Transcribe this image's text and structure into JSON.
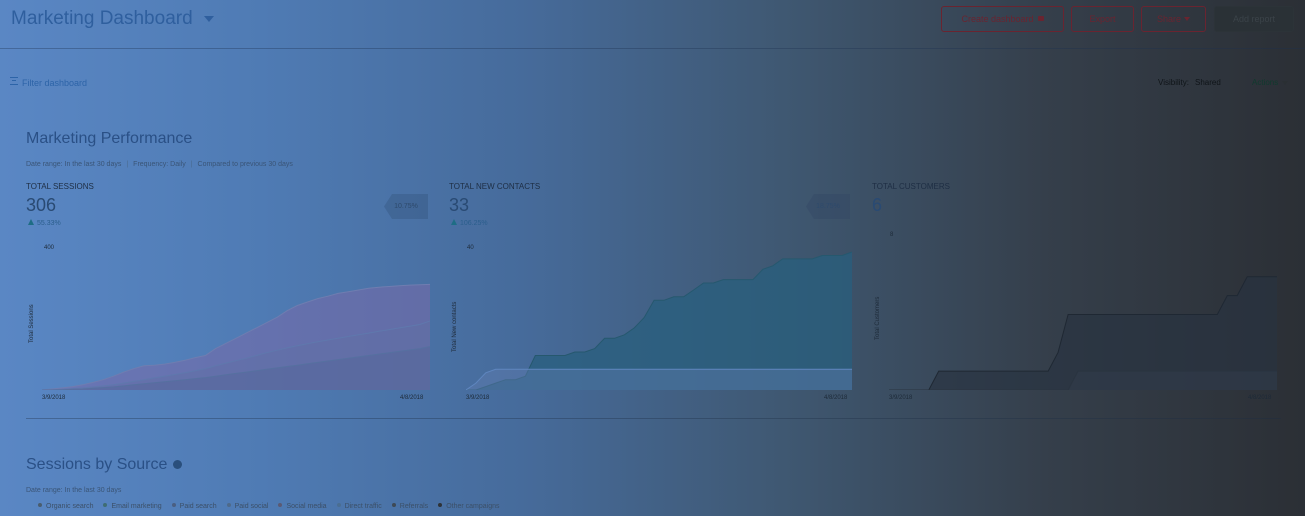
{
  "header": {
    "title": "Marketing Dashboard",
    "buttons": {
      "create": "Create dashboard",
      "export": "Export",
      "share": "Share",
      "add": "Add report"
    }
  },
  "toolbar": {
    "filter": "Filter dashboard",
    "visibility_label": "Visibility:",
    "visibility_value": "Shared",
    "actions": "Actions"
  },
  "performance": {
    "title": "Marketing Performance",
    "meta": {
      "date_range": "Date range: In the last 30 days",
      "frequency": "Frequency: Daily",
      "compare": "Compared to previous 30 days"
    },
    "kpis": [
      {
        "label": "TOTAL SESSIONS",
        "value": "306",
        "change": "55.33%",
        "badge": "10.75%"
      },
      {
        "label": "TOTAL NEW CONTACTS",
        "value": "33",
        "change": "106.25%",
        "badge": "18.75%"
      },
      {
        "label": "TOTAL CUSTOMERS",
        "value": "6"
      }
    ]
  },
  "chart_data": [
    {
      "type": "area",
      "title": "TOTAL SESSIONS",
      "ylabel": "Total Sessions",
      "ylim": [
        0,
        400
      ],
      "ytick_top": "400",
      "x_start": "3/9/2018",
      "x_end": "4/8/2018",
      "series": [
        {
          "values": [
            0,
            3,
            6,
            10,
            15,
            22,
            30,
            40,
            52,
            62,
            70,
            72,
            75,
            80,
            86,
            94,
            100,
            120,
            135,
            150,
            165,
            180,
            195,
            210,
            230,
            245,
            255,
            265,
            272,
            280,
            285,
            290,
            295,
            298,
            300,
            302,
            304,
            305,
            306
          ]
        },
        {
          "values": [
            0,
            1,
            2,
            4,
            6,
            9,
            12,
            15,
            20,
            25,
            30,
            35,
            40,
            45,
            50,
            56,
            62,
            70,
            78,
            85,
            92,
            100,
            108,
            115,
            122,
            128,
            134,
            140,
            145,
            150,
            155,
            160,
            165,
            170,
            175,
            180,
            185,
            190,
            200
          ]
        },
        {
          "values": [
            0,
            0,
            1,
            2,
            3,
            5,
            7,
            9,
            12,
            15,
            18,
            21,
            24,
            27,
            30,
            33,
            36,
            40,
            44,
            48,
            52,
            56,
            60,
            64,
            68,
            72,
            76,
            80,
            84,
            88,
            92,
            96,
            100,
            104,
            108,
            112,
            116,
            120,
            126
          ]
        }
      ]
    },
    {
      "type": "area",
      "title": "TOTAL NEW CONTACTS",
      "ylabel": "Total New contacts",
      "ylim": [
        0,
        40
      ],
      "ytick_top": "40",
      "x_start": "3/9/2018",
      "x_end": "4/8/2018",
      "series": [
        {
          "values": [
            0,
            0,
            1,
            2,
            3,
            3,
            4,
            10,
            10,
            10,
            10,
            11,
            11,
            12,
            15,
            15,
            16,
            18,
            21,
            26,
            26,
            27,
            27,
            29,
            31,
            31,
            32,
            32,
            32,
            32,
            35,
            36,
            38,
            38,
            38,
            38,
            39,
            39,
            39,
            40
          ]
        },
        {
          "values": [
            0,
            2,
            5,
            6,
            6,
            6,
            6,
            6,
            6,
            6,
            6,
            6,
            6,
            6,
            6,
            6,
            6,
            6,
            6,
            6,
            6,
            6,
            6,
            6,
            6,
            6,
            6,
            6,
            6,
            6,
            6,
            6,
            6,
            6,
            6,
            6,
            6,
            6,
            6,
            6
          ]
        }
      ]
    },
    {
      "type": "area",
      "title": "TOTAL CUSTOMERS",
      "ylabel": "Total Customers",
      "ylim": [
        0,
        8
      ],
      "ytick_top": "8",
      "x_start": "3/9/2018",
      "x_end": "4/8/2018",
      "series": [
        {
          "values": [
            0,
            0,
            0,
            0,
            0,
            1,
            1,
            1,
            1,
            1,
            1,
            1,
            1,
            1,
            1,
            1,
            1,
            2,
            4,
            4,
            4,
            4,
            4,
            4,
            4,
            4,
            4,
            4,
            4,
            4,
            4,
            4,
            4,
            4,
            5,
            5,
            6,
            6,
            6,
            6
          ]
        },
        {
          "values": [
            0,
            0,
            0,
            0,
            0,
            0,
            0,
            0,
            0,
            0,
            0,
            0,
            0,
            0,
            0,
            0,
            0,
            0,
            0,
            1,
            1,
            1,
            1,
            1,
            1,
            1,
            1,
            1,
            1,
            1,
            1,
            1,
            1,
            1,
            1,
            1,
            1,
            1,
            1,
            1
          ]
        }
      ]
    }
  ],
  "sessions_by_source": {
    "title": "Sessions by Source",
    "date_range": "Date range: In the last 30 days",
    "legend": [
      {
        "label": "Organic search",
        "color": "#4a5d6e"
      },
      {
        "label": "Email marketing",
        "color": "#3f6d74"
      },
      {
        "label": "Paid search",
        "color": "#4a5f82"
      },
      {
        "label": "Paid social",
        "color": "#4e6a8a"
      },
      {
        "label": "Social media",
        "color": "#5a5a74"
      },
      {
        "label": "Direct traffic",
        "color": "#4a6e92"
      },
      {
        "label": "Referrals",
        "color": "#3e4a56"
      },
      {
        "label": "Other campaigns",
        "color": "#2e3338"
      }
    ]
  },
  "colors": {
    "title": "#2f5f9e",
    "primary_action": "#6a2430",
    "link": "#2d64a8"
  }
}
